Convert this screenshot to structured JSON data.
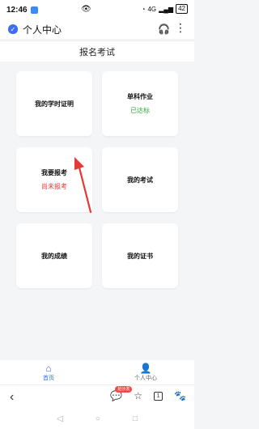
{
  "status_bar": {
    "time": "12:46",
    "eye_icon": "eye-icon",
    "network_text": "4G",
    "battery": "42"
  },
  "header": {
    "title": "个人中心",
    "shield_icon": "shield-check-icon",
    "headset_icon": "headset-icon",
    "more_icon": "more-vertical-icon"
  },
  "subheader": {
    "title": "报名考试"
  },
  "cards": [
    {
      "label": "我的学时证明",
      "status": ""
    },
    {
      "label": "单科作业",
      "status": "已达标"
    },
    {
      "label": "我要报考",
      "status": "尚未报考"
    },
    {
      "label": "我的考试",
      "status": ""
    },
    {
      "label": "我的成绩",
      "status": ""
    },
    {
      "label": "我的证书",
      "status": ""
    }
  ],
  "bottom_nav": {
    "home_label": "首页",
    "profile_label": "个人中心"
  },
  "browser_bar": {
    "comment_badge": "抢沙发",
    "tab_count": "1"
  },
  "colors": {
    "accent": "#2b6fe8",
    "ok": "#2faa3d",
    "pending": "#e23b3b",
    "arrow": "#e53935"
  }
}
